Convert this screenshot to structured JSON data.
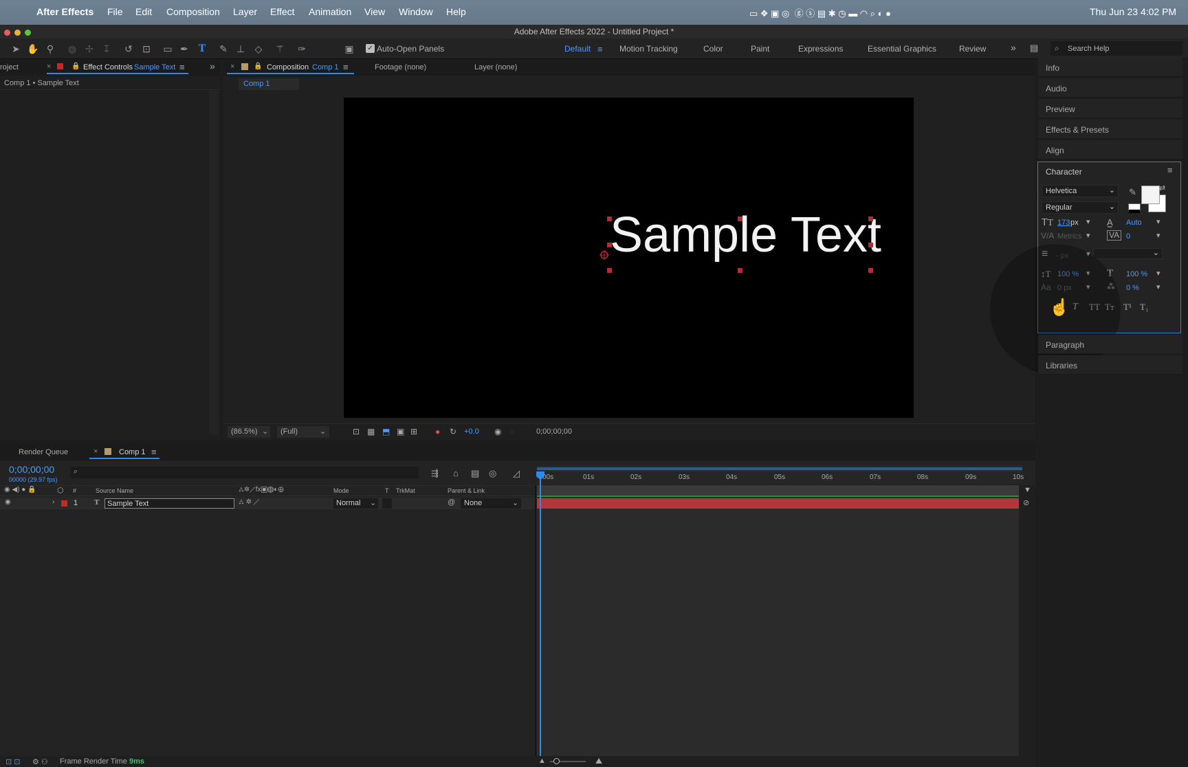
{
  "menubar": {
    "app": "After Effects",
    "items": [
      "File",
      "Edit",
      "Composition",
      "Layer",
      "Effect",
      "Animation",
      "View",
      "Window",
      "Help"
    ],
    "datetime": "Thu Jun 23  4:02 PM"
  },
  "window": {
    "title": "Adobe After Effects 2022 - Untitled Project *"
  },
  "toolbar": {
    "auto_open_label": "Auto-Open Panels",
    "workspaces": [
      "Default",
      "Motion Tracking",
      "Color",
      "Paint",
      "Expressions",
      "Essential Graphics",
      "Review"
    ],
    "search_placeholder": "Search Help"
  },
  "left_panel": {
    "project_tab": "roject",
    "effect_controls_label": "Effect Controls",
    "effect_controls_target": "Sample Text",
    "breadcrumb": "Comp 1 • Sample Text"
  },
  "comp_panel": {
    "composition_label": "Composition",
    "comp_name": "Comp 1",
    "footage_tab": "Footage (none)",
    "layer_tab": "Layer (none)",
    "comp_tab_chip": "Comp 1",
    "sample_text": "Sample Text",
    "zoom": "(86.5%)",
    "resolution": "(Full)",
    "exposure": "+0.0",
    "timecode": "0;00;00;00"
  },
  "right_panel": {
    "items": [
      "Info",
      "Audio",
      "Preview",
      "Effects & Presets",
      "Align"
    ],
    "bottom_items": [
      "Paragraph",
      "Libraries"
    ],
    "character": {
      "title": "Character",
      "font": "Helvetica",
      "style": "Regular",
      "size": "173",
      "size_unit": "px",
      "leading": "Auto",
      "kerning": "Metrics",
      "tracking": "0",
      "stroke_width": "- px",
      "vscale": "100 %",
      "hscale": "100 %",
      "baseline": "0 px",
      "tsume": "0 %"
    }
  },
  "timeline": {
    "render_queue_tab": "Render Queue",
    "comp_tab": "Comp 1",
    "current_time": "0;00;00;00",
    "frame_info": "00000 (29.97 fps)",
    "search_placeholder": "",
    "headers": {
      "num": "#",
      "source": "Source Name",
      "mode": "Mode",
      "t": "T",
      "trkmat": "TrkMat",
      "parent": "Parent & Link"
    },
    "ruler": [
      "00s",
      "01s",
      "02s",
      "03s",
      "04s",
      "05s",
      "06s",
      "07s",
      "08s",
      "09s",
      "10s"
    ],
    "layers": [
      {
        "index": "1",
        "type_icon": "T",
        "name": "Sample Text",
        "mode": "Normal",
        "parent": "None"
      }
    ]
  },
  "statusbar": {
    "label": "Frame Render Time",
    "value": "9ms"
  },
  "colors": {
    "accent": "#2d8ceb",
    "layer_label": "#c62828",
    "layer_bar": "#b3363b",
    "work_area": "#2b8f3a"
  }
}
